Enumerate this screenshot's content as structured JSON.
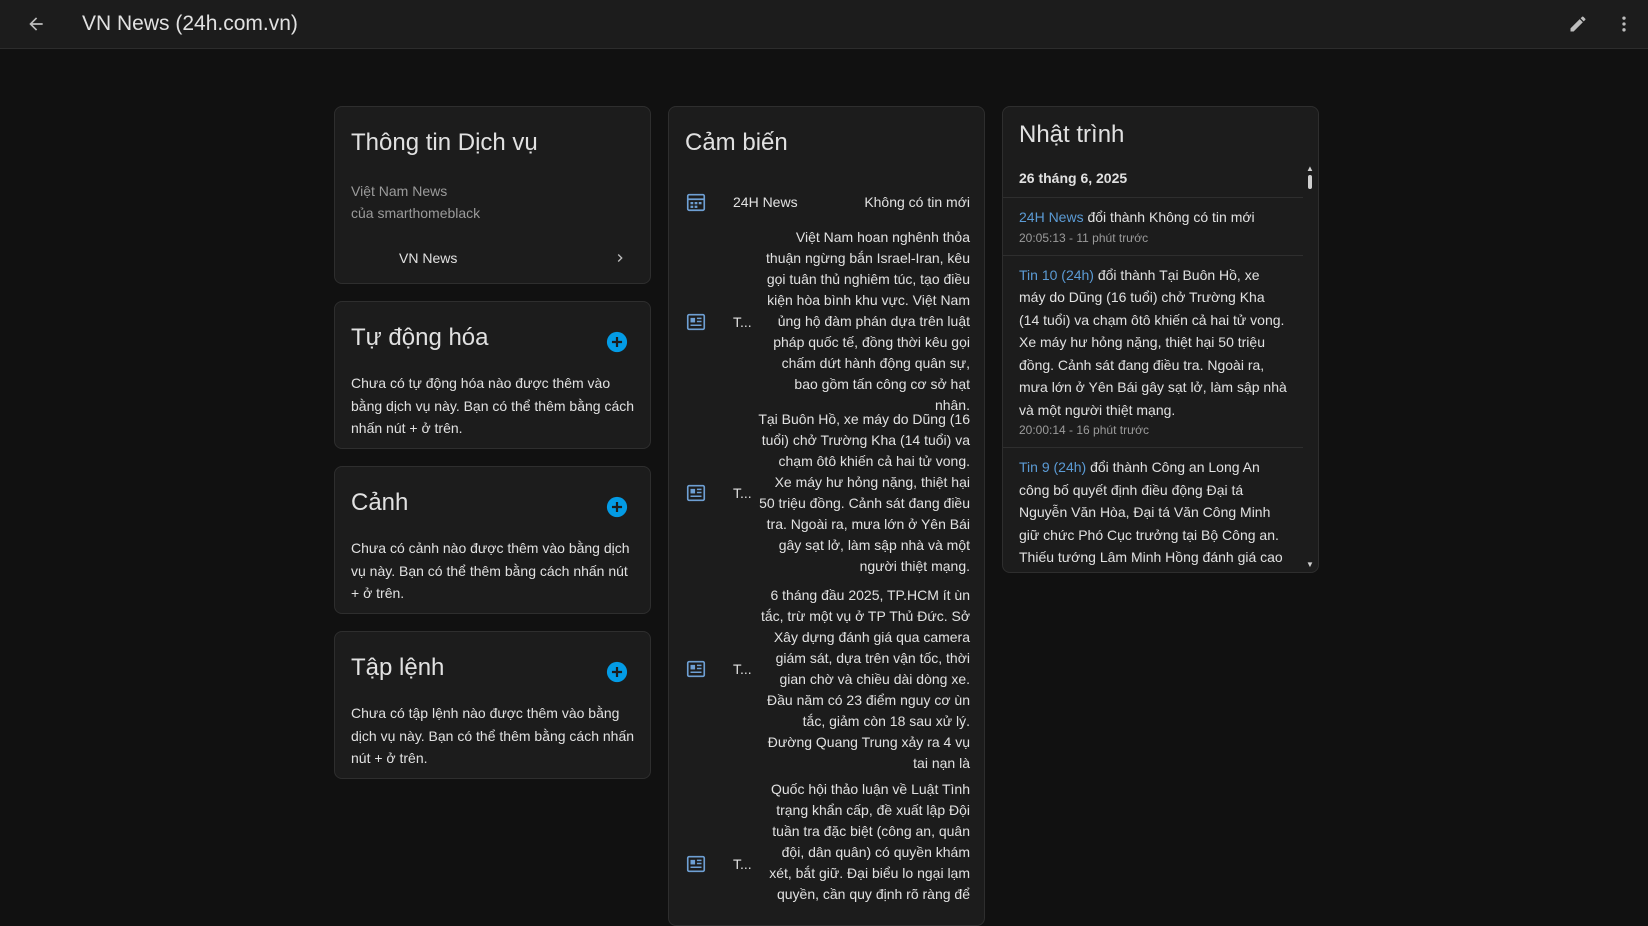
{
  "header": {
    "title": "VN News (24h.com.vn)"
  },
  "info": {
    "title": "Thông tin Dịch vụ",
    "service_name": "Việt Nam News",
    "owner": "của smarthomeblack",
    "device": "VN News"
  },
  "automation": {
    "title": "Tự động hóa",
    "desc": "Chưa có tự động hóa nào được thêm vào bằng dịch vụ này. Bạn có thể thêm bằng cách nhấn nút + ở trên."
  },
  "scene": {
    "title": "Cảnh",
    "desc": "Chưa có cảnh nào được thêm vào bằng dịch vụ này. Bạn có thể thêm bằng cách nhấn nút + ở trên."
  },
  "script": {
    "title": "Tập lệnh",
    "desc": "Chưa có tập lệnh nào được thêm vào bằng dịch vụ này. Bạn có thể thêm bằng cách nhấn nút + ở trên."
  },
  "sensors": {
    "title": "Cảm biến",
    "items": [
      {
        "name": "24H News",
        "state": "Không có tin mới",
        "icon": "calendar-icon"
      },
      {
        "name": "T...",
        "state": "Việt Nam hoan nghênh thỏa thuận ngừng bắn Israel-Iran, kêu gọi tuân thủ nghiêm túc, tạo điều kiện hòa bình khu vực. Việt Nam ủng hộ đàm phán dựa trên luật pháp quốc tế, đồng thời kêu gọi chấm dứt hành động quân sự, bao gồm tấn công cơ sở hạt nhân.",
        "icon": "newspaper-icon"
      },
      {
        "name": "T...",
        "state": "Tại Buôn Hồ, xe máy do Dũng (16 tuổi) chở Trường Kha (14 tuổi) va chạm ôtô khiến cả hai tử vong. Xe máy hư hỏng nặng, thiệt hại 50 triệu đồng. Cảnh sát đang điều tra. Ngoài ra, mưa lớn ở Yên Bái gây sạt lở, làm sập nhà và một người thiệt mạng.",
        "icon": "newspaper-icon"
      },
      {
        "name": "T...",
        "state": "6 tháng đầu 2025, TP.HCM ít ùn tắc, trừ một vụ ở TP Thủ Đức. Sở Xây dựng đánh giá qua camera giám sát, dựa trên vận tốc, thời gian chờ và chiều dài dòng xe. Đầu năm có 23 điểm nguy cơ ùn tắc, giảm còn 18 sau xử lý. Đường Quang Trung xảy ra 4 vụ tai nạn là",
        "icon": "newspaper-icon"
      },
      {
        "name": "T...",
        "state": "Quốc hội thảo luận về Luật Tình trạng khẩn cấp, đề xuất lập Đội tuần tra đặc biệt (công an, quân đội, dân quân) có quyền khám xét, bắt giữ. Đại biểu lo ngại lạm quyền, cần quy định rõ ràng để",
        "icon": "newspaper-icon"
      }
    ]
  },
  "logbook": {
    "title": "Nhật trình",
    "date": "26 tháng 6, 2025",
    "entries": [
      {
        "entity": "24H News",
        "message": "đổi thành Không có tin mới",
        "time": "20:05:13 - 11 phút trước"
      },
      {
        "entity": "Tin 10 (24h)",
        "message": "đổi thành Tại Buôn Hồ, xe máy do Dũng (16 tuổi) chở Trường Kha (14 tuổi) va chạm ôtô khiến cả hai tử vong. Xe máy hư hỏng nặng, thiệt hại 50 triệu đồng. Cảnh sát đang điều tra. Ngoài ra, mưa lớn ở Yên Bái gây sạt lở, làm sập nhà và một người thiệt mạng.",
        "time": "20:00:14 - 16 phút trước"
      },
      {
        "entity": "Tin 9 (24h)",
        "message": "đổi thành Công an Long An công bố quyết định điều động Đại tá Nguyễn Văn Hòa, Đại tá Văn Công Minh giữ chức Phó Cục trưởng tại Bộ Công an. Thiếu tướng Lâm Minh Hồng đánh giá cao đóng",
        "time": ""
      }
    ]
  },
  "colors": {
    "accent": "#039be5",
    "entity_link": "#5b9bd5",
    "icon_blue": "#6e9fd3"
  }
}
